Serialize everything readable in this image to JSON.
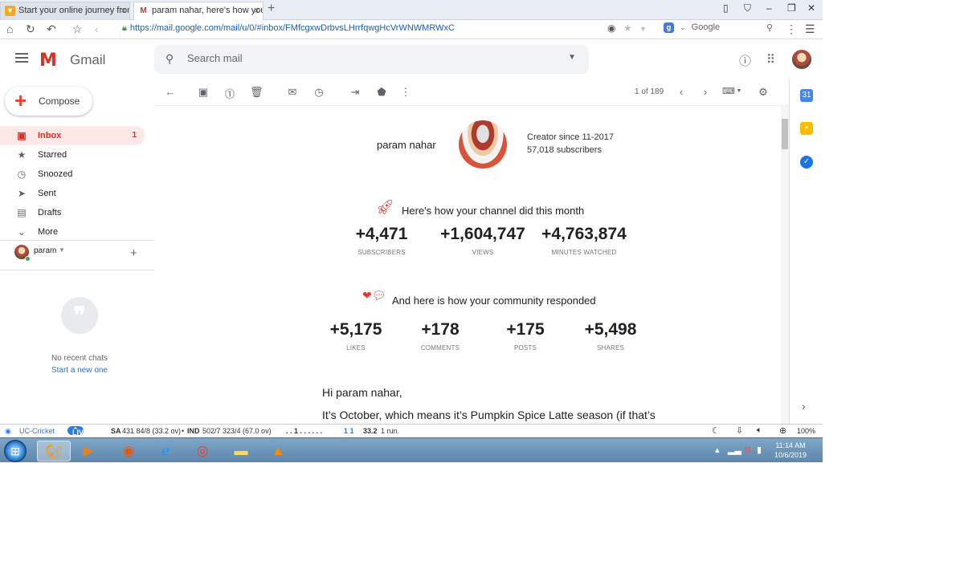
{
  "browser": {
    "tabs": [
      {
        "label": "Start your online journey from",
        "icon": "tab-favicon"
      },
      {
        "label": "param nahar, here's how your",
        "icon": "gmail-favicon"
      }
    ],
    "url": "https://mail.google.com/mail/u/0/#inbox/FMfcgxwDrbvsLHrrfqwgHcVrWNWMRWxC",
    "search_engine": "Google"
  },
  "gmail": {
    "product_name": "Gmail",
    "search_placeholder": "Search mail",
    "compose_label": "Compose",
    "nav": [
      {
        "label": "Inbox",
        "count": "1",
        "icon": "inbox-icon"
      },
      {
        "label": "Starred",
        "count": "",
        "icon": "star-icon"
      },
      {
        "label": "Snoozed",
        "count": "",
        "icon": "clock-icon"
      },
      {
        "label": "Sent",
        "count": "",
        "icon": "send-icon"
      },
      {
        "label": "Drafts",
        "count": "",
        "icon": "draft-icon"
      },
      {
        "label": "More",
        "count": "",
        "icon": "chevron-down-icon"
      }
    ],
    "chat_user": "param",
    "no_chats_text": "No recent chats",
    "start_new_text": "Start a new one",
    "pager_text": "1 of 189"
  },
  "email": {
    "channel_name": "param nahar",
    "creator_since": "Creator since 11-2017",
    "subscribers_text": "57,018 subscribers",
    "month_title": "Here's how your channel did this month",
    "month_stats": [
      {
        "value": "+4,471",
        "label": "SUBSCRIBERS"
      },
      {
        "value": "+1,604,747",
        "label": "VIEWS"
      },
      {
        "value": "+4,763,874",
        "label": "MINUTES WATCHED"
      }
    ],
    "community_title": "And here is how your community responded",
    "community_stats": [
      {
        "value": "+5,175",
        "label": "LIKES"
      },
      {
        "value": "+178",
        "label": "COMMENTS"
      },
      {
        "value": "+175",
        "label": "POSTS"
      },
      {
        "value": "+5,498",
        "label": "SHARES"
      }
    ],
    "greeting": "Hi param nahar,",
    "body_line": "It’s October, which means it’s Pumpkin Spice Latte season (if that’s"
  },
  "statusbar": {
    "app": "UC-Cricket",
    "live": "LIVE",
    "sa_label": "SA",
    "sa_score": "431 84/8 (33.2 ov)",
    "ind_label": "IND",
    "ind_score": "502/7 323/4 (67.0 ov)",
    "ball_seq": ". .  1 . . . . . .",
    "ball_extra": "1 1",
    "over": "33.2",
    "run_text": "1 run.",
    "zoom": "100%"
  },
  "taskbar": {
    "time": "11:14 AM",
    "date": "10/6/2019"
  },
  "colors": {
    "gmail_red": "#d93025",
    "inbox_active_bg": "#fce8e6",
    "link_blue": "#1a73e8"
  }
}
